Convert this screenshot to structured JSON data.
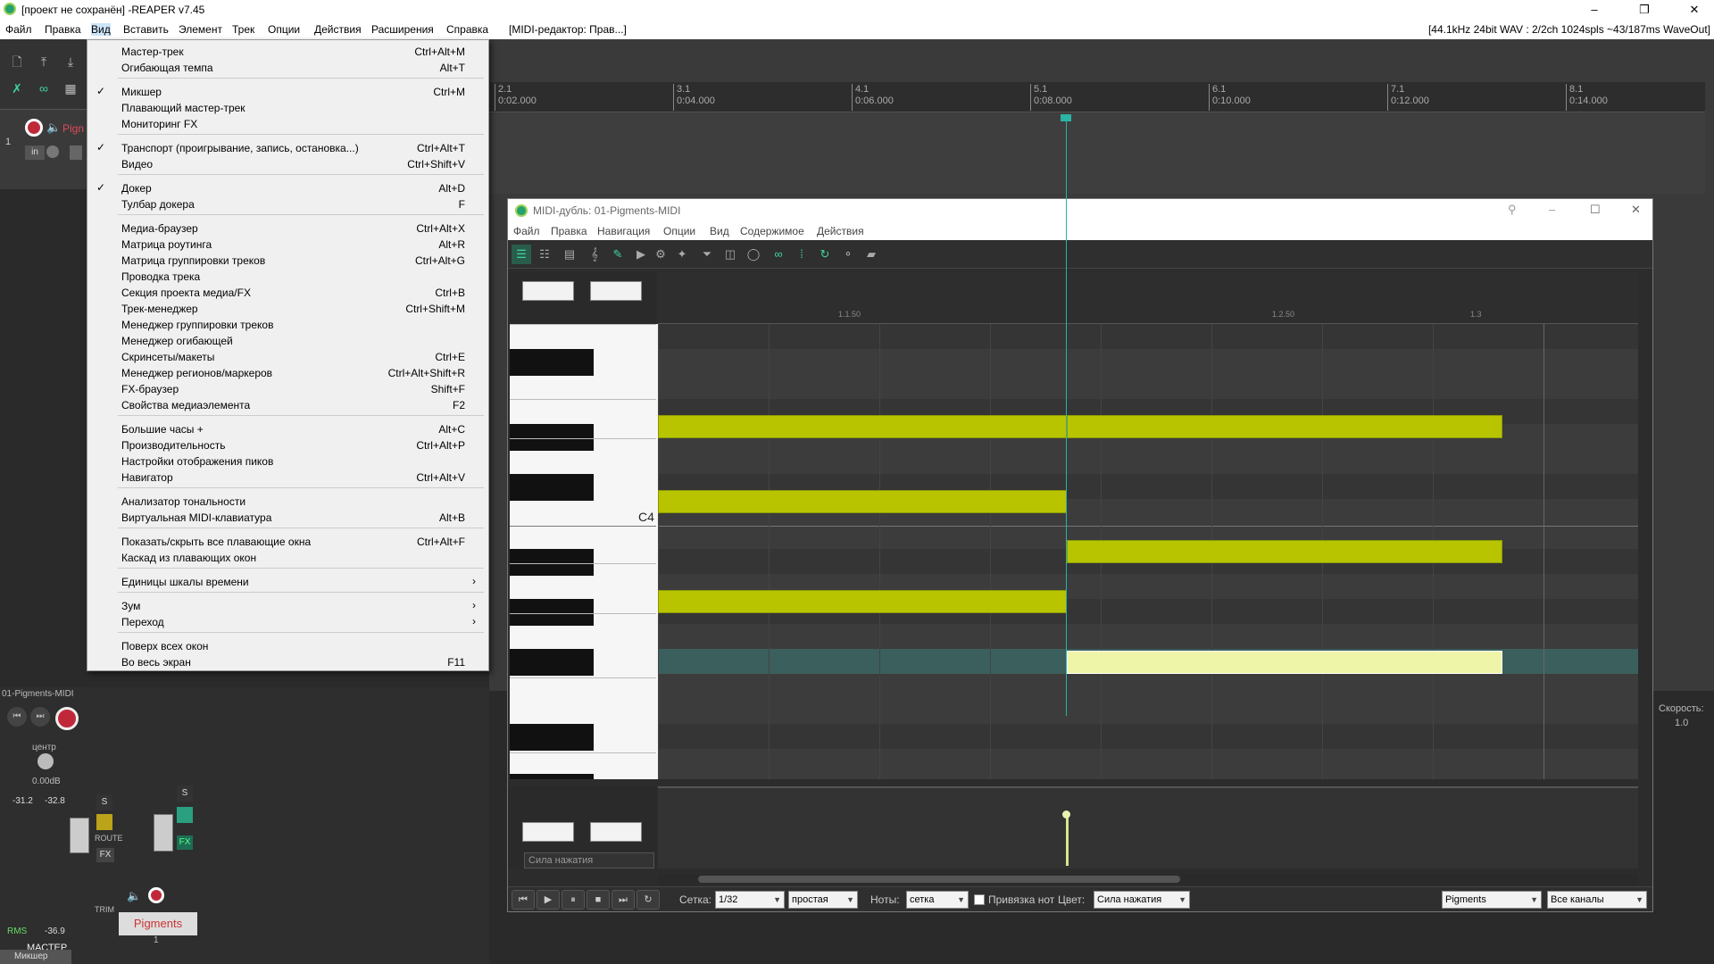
{
  "window": {
    "title": "[проект не сохранён] -REAPER v7.45",
    "controls": [
      "–",
      "❐",
      "✕"
    ]
  },
  "menubar": {
    "items": [
      "Файл",
      "Правка",
      "Вид",
      "Вставить",
      "Элемент",
      "Трек",
      "Опции",
      "Действия",
      "Расширения",
      "Справка",
      "[MIDI-редактор: Прав...]"
    ],
    "status": "[44.1kHz 24bit WAV : 2/2ch 1024spls ~43/187ms WaveOut]"
  },
  "ruler": {
    "marks": [
      {
        "bar": "2.1",
        "time": "0:02.000"
      },
      {
        "bar": "3.1",
        "time": "0:04.000"
      },
      {
        "bar": "4.1",
        "time": "0:06.000"
      },
      {
        "bar": "5.1",
        "time": "0:08.000"
      },
      {
        "bar": "6.1",
        "time": "0:10.000"
      },
      {
        "bar": "7.1",
        "time": "0:12.000"
      },
      {
        "bar": "8.1",
        "time": "0:14.000"
      }
    ]
  },
  "track": {
    "number": "1",
    "name": "Pign",
    "in_label": "in"
  },
  "view_menu": {
    "items": [
      {
        "label": "Мастер-трек",
        "shortcut": "Ctrl+Alt+M",
        "checked": false
      },
      {
        "label": "Огибающая темпа",
        "shortcut": "Alt+T",
        "checked": false
      },
      {
        "sep": true
      },
      {
        "label": "Микшер",
        "shortcut": "Ctrl+M",
        "checked": true
      },
      {
        "label": "Плавающий мастер-трек",
        "shortcut": "",
        "checked": false
      },
      {
        "label": "Мониторинг FX",
        "shortcut": "",
        "checked": false
      },
      {
        "sep": true
      },
      {
        "label": "Транспорт (проигрывание, запись, остановка...)",
        "shortcut": "Ctrl+Alt+T",
        "checked": true
      },
      {
        "label": "Видео",
        "shortcut": "Ctrl+Shift+V",
        "checked": false
      },
      {
        "sep": true
      },
      {
        "label": "Докер",
        "shortcut": "Alt+D",
        "checked": true
      },
      {
        "label": "Тулбар докера",
        "shortcut": "F",
        "checked": false
      },
      {
        "sep": true
      },
      {
        "label": "Медиа-браузер",
        "shortcut": "Ctrl+Alt+X",
        "checked": false
      },
      {
        "label": "Матрица роутинга",
        "shortcut": "Alt+R",
        "checked": false
      },
      {
        "label": "Матрица группировки треков",
        "shortcut": "Ctrl+Alt+G",
        "checked": false
      },
      {
        "label": "Проводка трека",
        "shortcut": "",
        "checked": false
      },
      {
        "label": "Секция проекта медиа/FX",
        "shortcut": "Ctrl+B",
        "checked": false
      },
      {
        "label": "Трек-менеджер",
        "shortcut": "Ctrl+Shift+M",
        "checked": false
      },
      {
        "label": "Менеджер группировки треков",
        "shortcut": "",
        "checked": false
      },
      {
        "label": "Менеджер огибающей",
        "shortcut": "",
        "checked": false
      },
      {
        "label": "Скринсеты/макеты",
        "shortcut": "Ctrl+E",
        "checked": false
      },
      {
        "label": "Менеджер регионов/маркеров",
        "shortcut": "Ctrl+Alt+Shift+R",
        "checked": false
      },
      {
        "label": "FX-браузер",
        "shortcut": "Shift+F",
        "checked": false
      },
      {
        "label": "Свойства медиаэлемента",
        "shortcut": "F2",
        "checked": false
      },
      {
        "sep": true
      },
      {
        "label": "Большие часы +",
        "shortcut": "Alt+C",
        "checked": false
      },
      {
        "label": "Производительность",
        "shortcut": "Ctrl+Alt+P",
        "checked": false
      },
      {
        "label": "Настройки отображения пиков",
        "shortcut": "",
        "checked": false
      },
      {
        "label": "Навигатор",
        "shortcut": "Ctrl+Alt+V",
        "checked": false
      },
      {
        "sep": true
      },
      {
        "label": "Анализатор тональности",
        "shortcut": "",
        "checked": false
      },
      {
        "label": "Виртуальная MIDI-клавиатура",
        "shortcut": "Alt+B",
        "checked": false
      },
      {
        "sep": true
      },
      {
        "label": "Показать/скрыть все плавающие окна",
        "shortcut": "Ctrl+Alt+F",
        "checked": false
      },
      {
        "label": "Каскад из плавающих окон",
        "shortcut": "",
        "checked": false
      },
      {
        "sep": true
      },
      {
        "label": "Единицы шкалы времени",
        "shortcut": "",
        "checked": false,
        "submenu": true
      },
      {
        "sep": true
      },
      {
        "label": "Зум",
        "shortcut": "",
        "checked": false,
        "submenu": true
      },
      {
        "label": "Переход",
        "shortcut": "",
        "checked": false,
        "submenu": true
      },
      {
        "sep": true
      },
      {
        "label": "Поверх всех окон",
        "shortcut": "",
        "checked": false
      },
      {
        "label": "Во весь экран",
        "shortcut": "F11",
        "checked": false
      }
    ]
  },
  "midi_editor": {
    "title": "MIDI-дубль: 01-Pigments-MIDI",
    "menu": [
      "Файл",
      "Правка",
      "Навигация",
      "Опции",
      "Вид",
      "Содержимое",
      "Действия"
    ],
    "ruler_labels": [
      "1.1.50",
      "1.2.50",
      "1.3"
    ],
    "c4_label": "C4",
    "velocity_lane": "Сила нажатия",
    "bottom": {
      "grid_label": "Сетка:",
      "grid_value": "1/32",
      "grid_type": "простая",
      "notes_label": "Ноты:",
      "notes_value": "сетка",
      "snap_label": "Привязка нот",
      "color_label": "Цвет:",
      "color_value": "Сила нажатия",
      "instrument": "Pigments",
      "channels": "Все каналы"
    }
  },
  "mixer": {
    "take_label": "01-Pigments-MIDI",
    "pan_label": "центр",
    "volume": "0.00dB",
    "peak_l": "-31.2",
    "peak_r": "-32.8",
    "rms_label": "RMS",
    "rms_value": "-36.9",
    "master_label": "МАСТЕР",
    "route_label": "ROUTE",
    "trim_label": "TRIM",
    "fx_label": "FX",
    "solo_label": "S",
    "track_name": "Pigments",
    "track_num": "1",
    "mixer_tab": "Микшер",
    "speed_label": "Скорость:",
    "speed_value": "1.0"
  },
  "colors": {
    "note": "#b8c400",
    "note_selected": "#eef5a8",
    "playhead": "#2bb3a3",
    "accent_green": "#3fd39a"
  }
}
